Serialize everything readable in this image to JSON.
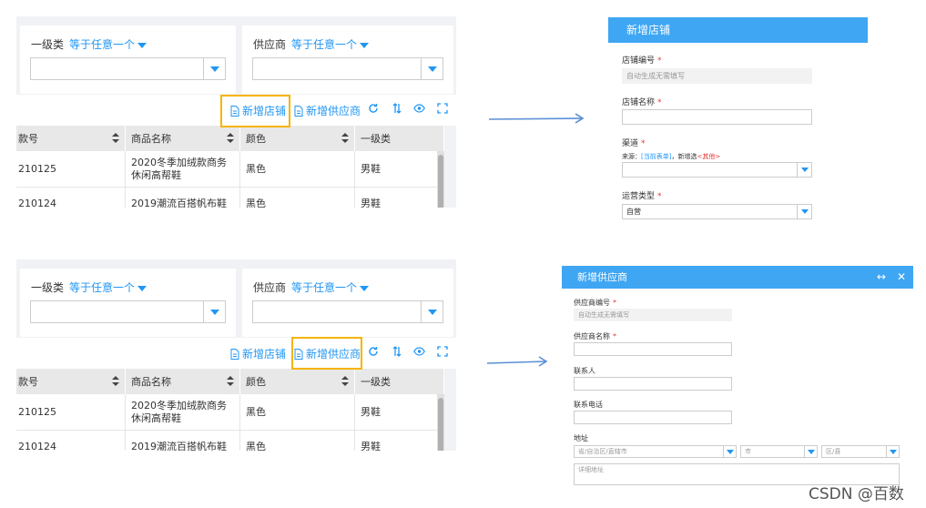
{
  "filter": {
    "field1": "一级类",
    "field2": "供应商",
    "operator": "等于任意一个"
  },
  "toolbar": {
    "add_store": "新增店铺",
    "add_supplier": "新增供应商",
    "icons": [
      "refresh-icon",
      "sort-icon",
      "eye-icon",
      "fullscreen-icon"
    ]
  },
  "grid": {
    "columns": [
      "款号",
      "商品名称",
      "颜色",
      "一级类"
    ],
    "rows": [
      {
        "code": "210125",
        "name": "2020冬季加绒款商务休闲高帮鞋",
        "color": "黑色",
        "category": "男鞋"
      },
      {
        "code": "210124",
        "name": "2019潮流百搭帆布鞋",
        "color": "黑色",
        "category": "男鞋"
      }
    ]
  },
  "store_dialog": {
    "title": "新增店铺",
    "fields": {
      "store_no": "店铺编号",
      "store_no_placeholder": "自动生成无需填写",
      "store_name": "店铺名称",
      "channel": "渠道",
      "channel_hint_prefix": "来源：",
      "channel_hint_link": "[当前表单]",
      "channel_hint_mid": "，新增选",
      "channel_hint_other": "<其他>",
      "op_type": "运营类型",
      "op_type_value": "自营"
    }
  },
  "supplier_dialog": {
    "title": "新增供应商",
    "header_icons": [
      "expand-icon",
      "close-icon"
    ],
    "fields": {
      "supplier_no": "供应商编号",
      "supplier_no_placeholder": "自动生成无需填写",
      "supplier_name": "供应商名称",
      "contact": "联系人",
      "phone": "联系电话",
      "address": "地址",
      "province_placeholder": "省/自治区/直辖市",
      "city_placeholder": "市",
      "district_placeholder": "区/县",
      "detail_placeholder": "详细地址"
    }
  },
  "watermark": "CSDN @百数",
  "colors": {
    "accent": "#2196f3",
    "dialog_header": "#3fa6f3",
    "highlight": "#f5b400",
    "required": "#e53935"
  }
}
